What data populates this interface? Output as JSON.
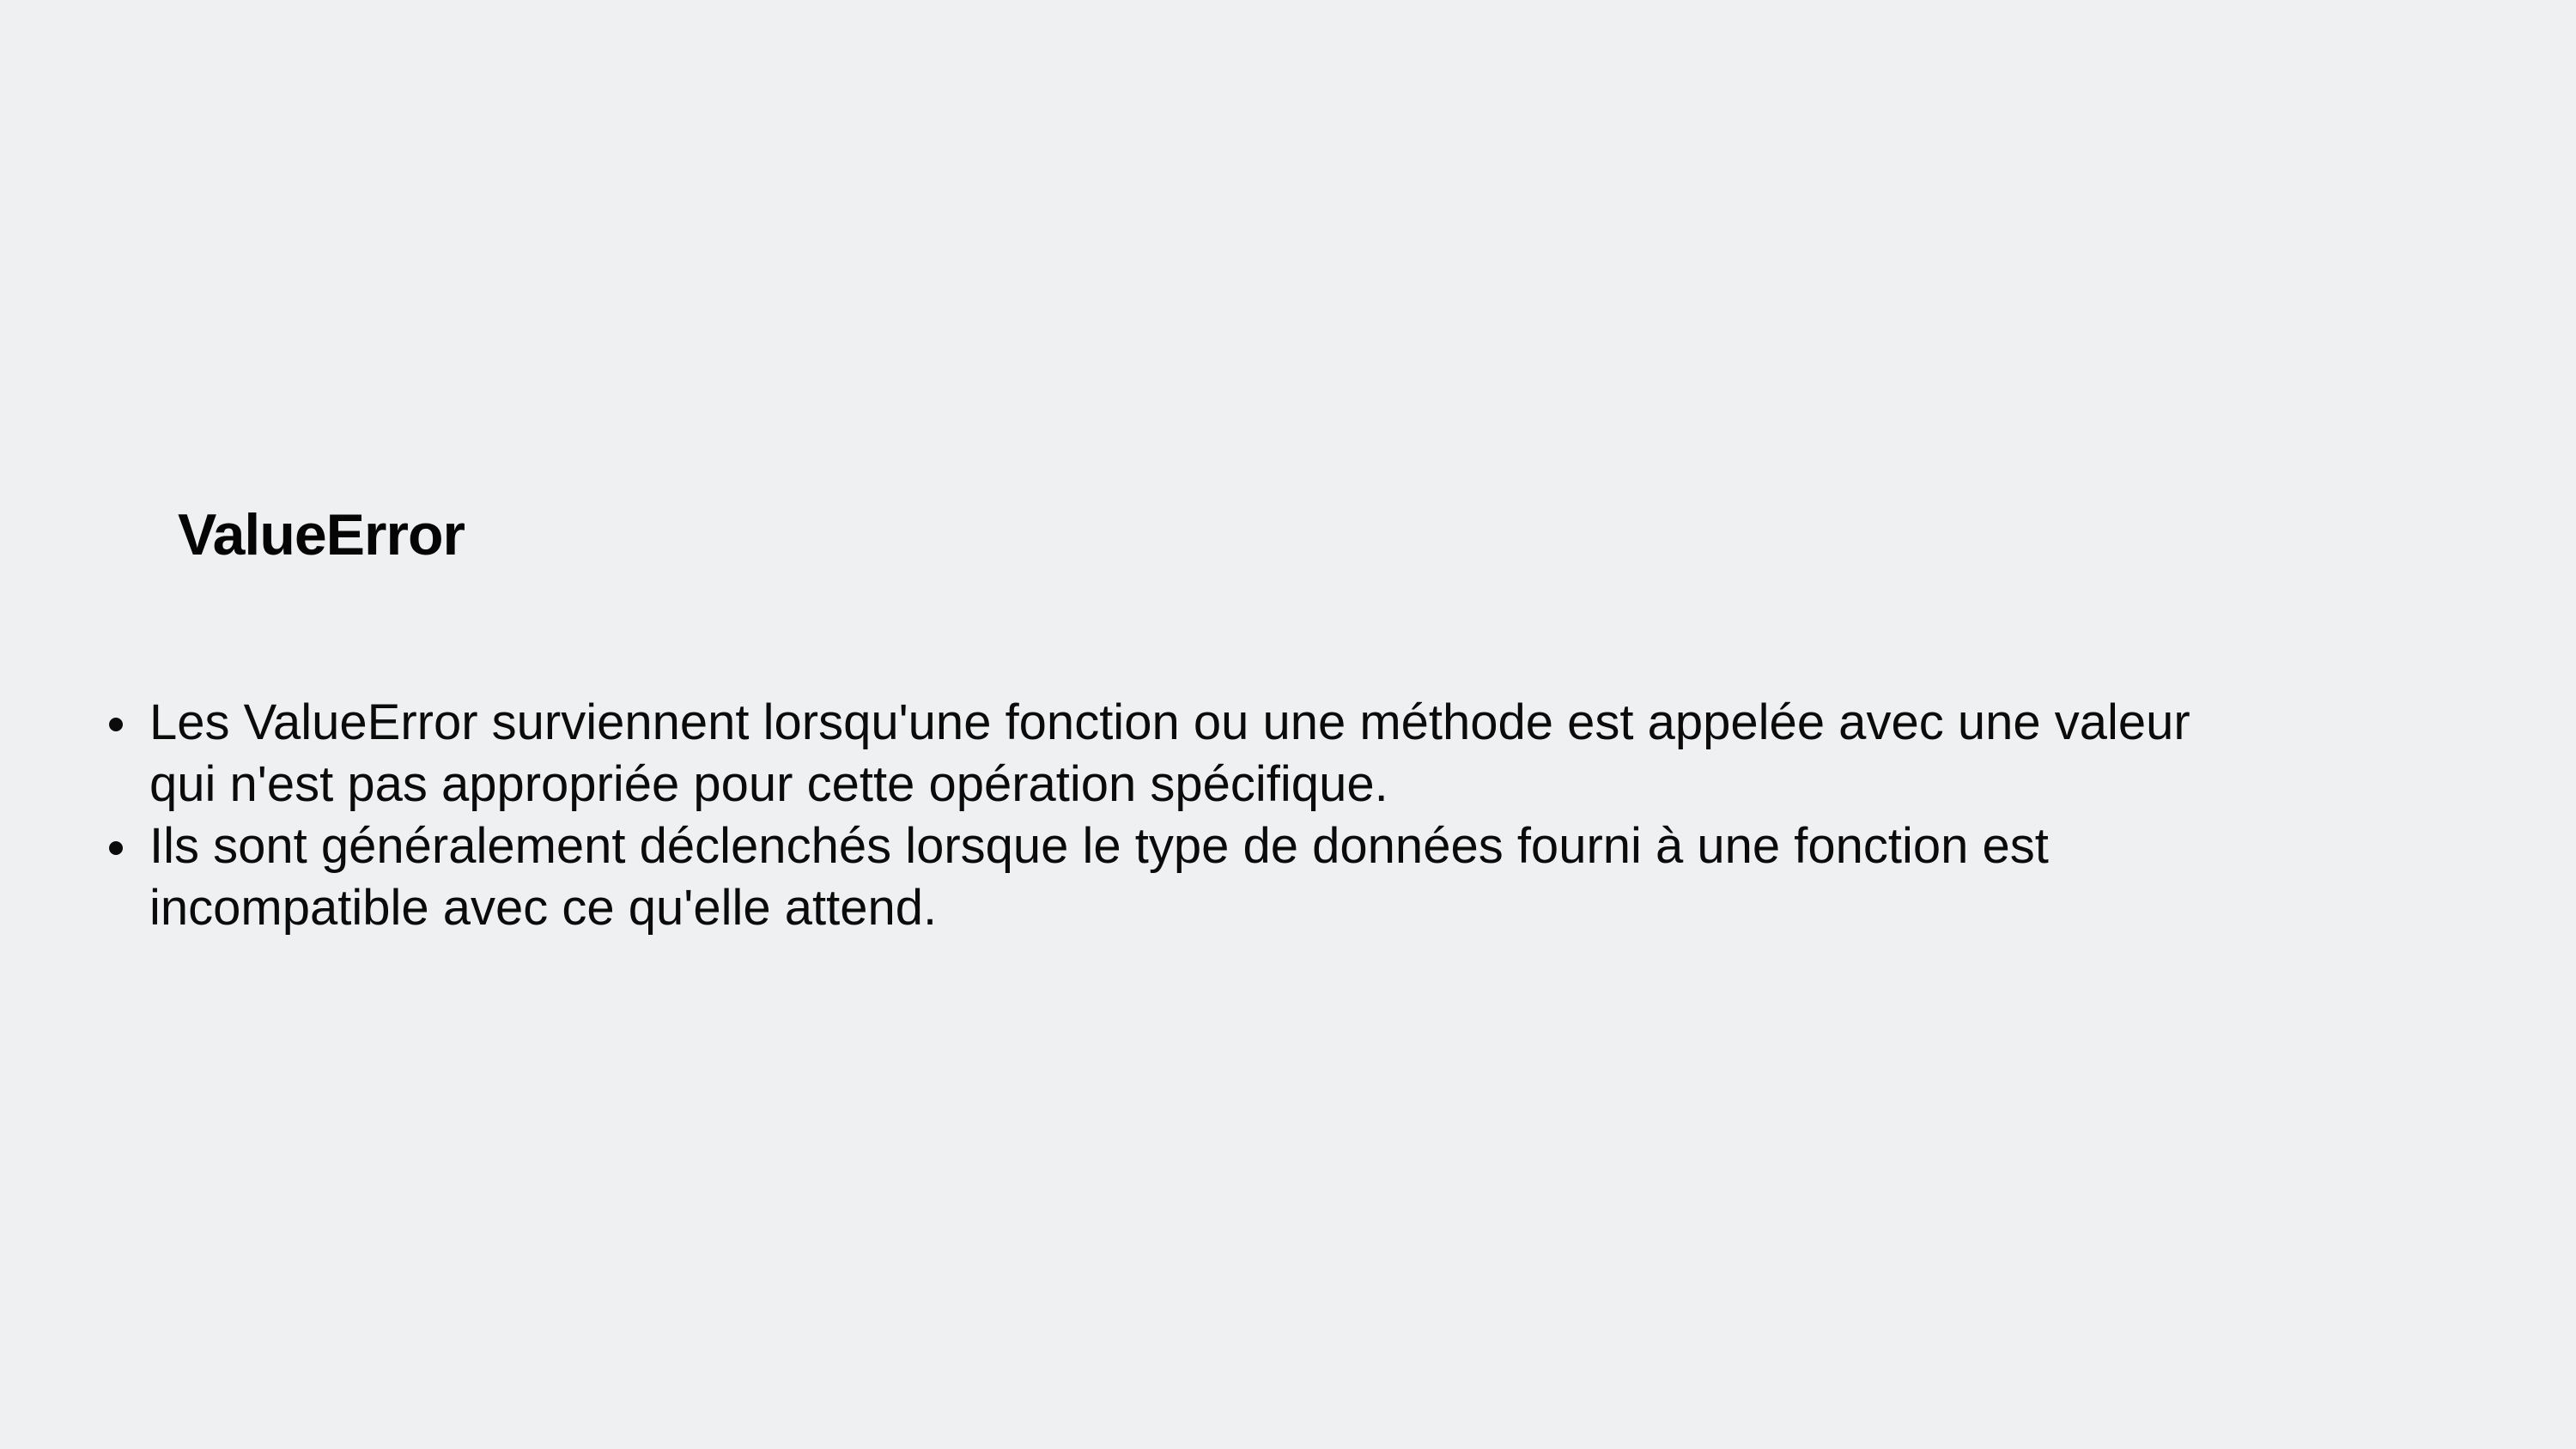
{
  "slide": {
    "title": "ValueError",
    "bullets": [
      {
        "line1": "Les ValueError surviennent lorsqu'une fonction ou une méthode est appelée avec une valeur",
        "line2": "qui n'est pas appropriée pour cette opération spécifique."
      },
      {
        "line1": "Ils sont généralement déclenchés lorsque le type de données fourni à une fonction est",
        "line2": "incompatible avec ce qu'elle attend."
      }
    ]
  },
  "colors": {
    "background": "#eff0f2",
    "text": "#0b0b0b"
  }
}
